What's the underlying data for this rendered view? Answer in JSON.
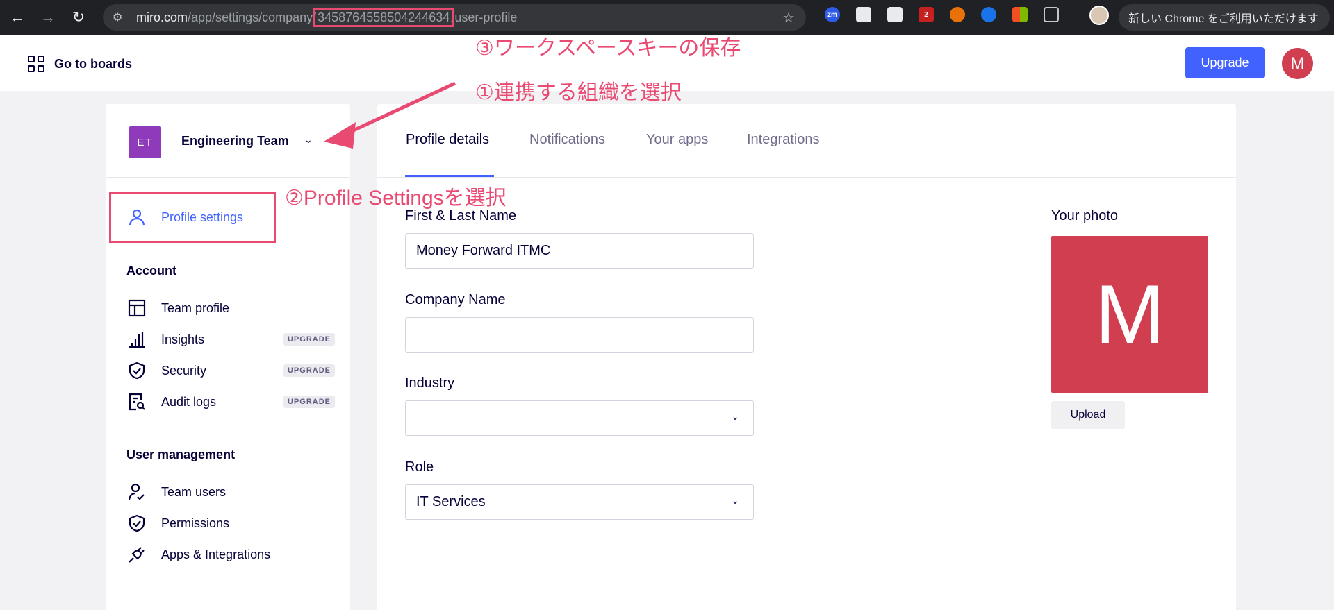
{
  "browser": {
    "url_host": "miro.com",
    "url_path": "/app/settings/company/",
    "url_company_id": "3458764558504244634",
    "url_tail": "/user-profile",
    "chrome_banner": "新しい Chrome をご利用いただけます",
    "extensions": [
      "zm",
      "",
      "",
      "2",
      "",
      "",
      "",
      ""
    ]
  },
  "header": {
    "goto_label": "Go to boards",
    "upgrade_label": "Upgrade",
    "avatar_letter": "M"
  },
  "sidebar": {
    "team_badge": "ET",
    "team_name": "Engineering Team",
    "profile_item": "Profile settings",
    "account_title": "Account",
    "account_items": [
      {
        "label": "Team profile",
        "badge": ""
      },
      {
        "label": "Insights",
        "badge": "UPGRADE"
      },
      {
        "label": "Security",
        "badge": "UPGRADE"
      },
      {
        "label": "Audit logs",
        "badge": "UPGRADE"
      }
    ],
    "user_mgmt_title": "User management",
    "user_mgmt_items": [
      {
        "label": "Team users"
      },
      {
        "label": "Permissions"
      },
      {
        "label": "Apps & Integrations"
      }
    ]
  },
  "main": {
    "tabs": [
      "Profile details",
      "Notifications",
      "Your apps",
      "Integrations"
    ],
    "active_tab": "Profile details",
    "name_label": "First & Last Name",
    "name_value": "Money Forward ITMC",
    "company_label": "Company Name",
    "company_value": "",
    "industry_label": "Industry",
    "industry_value": "",
    "role_label": "Role",
    "role_value": "IT Services",
    "photo_label": "Your photo",
    "photo_letter": "M",
    "upload_label": "Upload"
  },
  "annotations": {
    "step1": "①連携する組織を選択",
    "step2": "②Profile Settingsを選択",
    "step3": "③ワークスペースキーの保存"
  },
  "colors": {
    "accent": "#4262ff",
    "annotation": "#e84a72",
    "avatar": "#d03e50",
    "team_badge": "#8f3aba"
  }
}
